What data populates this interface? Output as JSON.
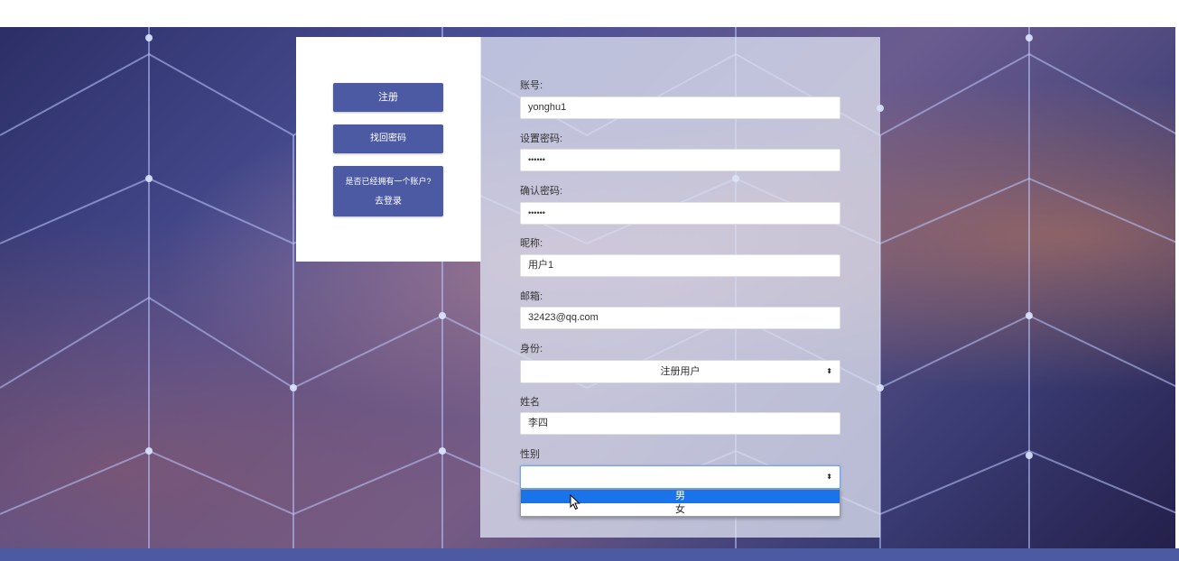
{
  "sidebar": {
    "register_label": "注册",
    "recover_label": "找回密码",
    "have_account_text": "是否已经拥有一个账户?",
    "login_label": "去登录"
  },
  "form": {
    "account": {
      "label": "账号:",
      "value": "yonghu1"
    },
    "password": {
      "label": "设置密码:",
      "value": "••••••"
    },
    "confirm": {
      "label": "确认密码:",
      "value": "••••••"
    },
    "nickname": {
      "label": "昵称:",
      "value": "用户1"
    },
    "email": {
      "label": "邮箱:",
      "value": "32423@qq.com"
    },
    "identity": {
      "label": "身份:",
      "selected": "注册用户"
    },
    "name": {
      "label": "姓名",
      "value": "李四"
    },
    "gender": {
      "label": "性别",
      "selected": "",
      "options": [
        "男",
        "女"
      ]
    }
  },
  "colors": {
    "accent": "#4c5aa3",
    "highlight": "#1a73e8"
  },
  "icons": {
    "select_arrows": "up-down-arrows-icon",
    "cursor": "mouse-pointer-icon"
  }
}
